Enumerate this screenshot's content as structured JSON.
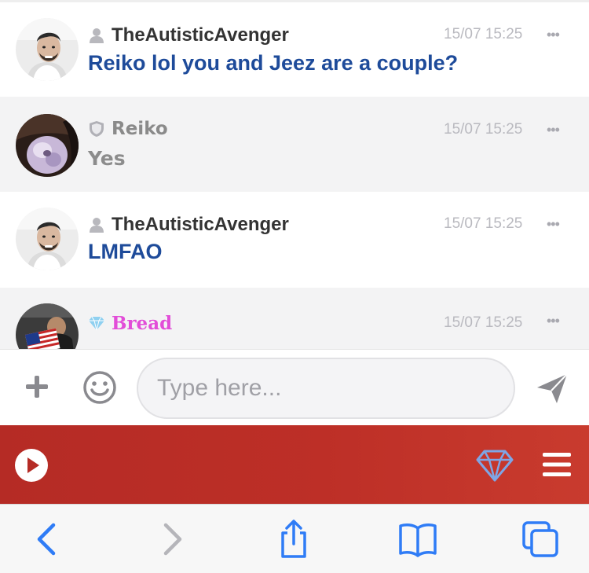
{
  "chat": {
    "messages": [
      {
        "username": "TheAutisticAvenger",
        "time": "15/07 15:25",
        "text": "Reiko lol you and Jeez are a couple?",
        "user_icon": "person-icon"
      },
      {
        "username": "Reiko",
        "time": "15/07 15:25",
        "text": "Yes",
        "user_icon": "shield-icon"
      },
      {
        "username": "TheAutisticAvenger",
        "time": "15/07 15:25",
        "text": "LMFAO",
        "user_icon": "person-icon"
      },
      {
        "username": "Bread",
        "time": "15/07 15:25",
        "text": "",
        "user_icon": "diamond-icon"
      }
    ],
    "more_label": "•••"
  },
  "composer": {
    "placeholder": "Type here...",
    "icons": {
      "add": "plus-icon",
      "emoji": "smiley-icon",
      "send": "paper-plane-icon"
    }
  },
  "appbar": {
    "icons": {
      "play": "play-icon",
      "premium": "diamond-icon",
      "menu": "hamburger-menu-icon"
    }
  },
  "browser_toolbar": {
    "icons": [
      "back-arrow-icon",
      "forward-arrow-icon",
      "share-icon",
      "bookmarks-icon",
      "tabs-icon"
    ]
  },
  "colors": {
    "accent_blue": "#1e4b9a",
    "appbar_red": "#bd2f27",
    "browser_blue": "#2f7cf6",
    "bread_pink": "#e24dd8"
  }
}
